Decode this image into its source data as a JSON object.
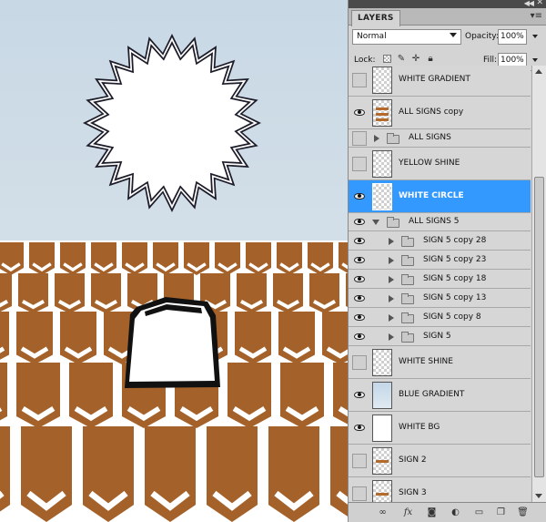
{
  "panel": {
    "tab_label": "LAYERS",
    "blend_mode": "Normal",
    "opacity_label": "Opacity:",
    "opacity_value": "100%",
    "lock_label": "Lock:",
    "fill_label": "Fill:",
    "fill_value": "100%"
  },
  "layers": [
    {
      "name": "WHITE GRADIENT",
      "visible": false,
      "kind": "layer",
      "thumb": "checker"
    },
    {
      "name": "ALL SIGNS copy",
      "visible": true,
      "kind": "layer",
      "thumb": "signs"
    },
    {
      "name": "ALL SIGNS",
      "visible": false,
      "kind": "group",
      "expanded": false
    },
    {
      "name": "YELLOW SHINE",
      "visible": false,
      "kind": "layer",
      "thumb": "checker"
    },
    {
      "name": "WHITE CIRCLE",
      "visible": true,
      "kind": "layer",
      "thumb": "checker",
      "selected": true
    },
    {
      "name": "ALL SIGNS 5",
      "visible": true,
      "kind": "group",
      "expanded": true
    },
    {
      "name": "SIGN 5 copy 28",
      "visible": true,
      "kind": "subgroup"
    },
    {
      "name": "SIGN 5 copy 23",
      "visible": true,
      "kind": "subgroup"
    },
    {
      "name": "SIGN 5 copy 18",
      "visible": true,
      "kind": "subgroup"
    },
    {
      "name": "SIGN 5 copy 13",
      "visible": true,
      "kind": "subgroup"
    },
    {
      "name": "SIGN 5 copy 8",
      "visible": true,
      "kind": "subgroup"
    },
    {
      "name": "SIGN 5",
      "visible": true,
      "kind": "subgroup"
    },
    {
      "name": "WHITE SHINE",
      "visible": false,
      "kind": "layer",
      "thumb": "checker"
    },
    {
      "name": "BLUE GRADIENT",
      "visible": true,
      "kind": "layer",
      "thumb": "blue"
    },
    {
      "name": "WHITE BG",
      "visible": true,
      "kind": "layer",
      "thumb": "white"
    },
    {
      "name": "SIGN 2",
      "visible": false,
      "kind": "layer",
      "thumb": "sign"
    },
    {
      "name": "SIGN 3",
      "visible": false,
      "kind": "layer",
      "thumb": "sign"
    }
  ],
  "colors": {
    "selection": "#3399ff",
    "sign_brown": "#a4622a",
    "sky": "#c9d8e4"
  }
}
